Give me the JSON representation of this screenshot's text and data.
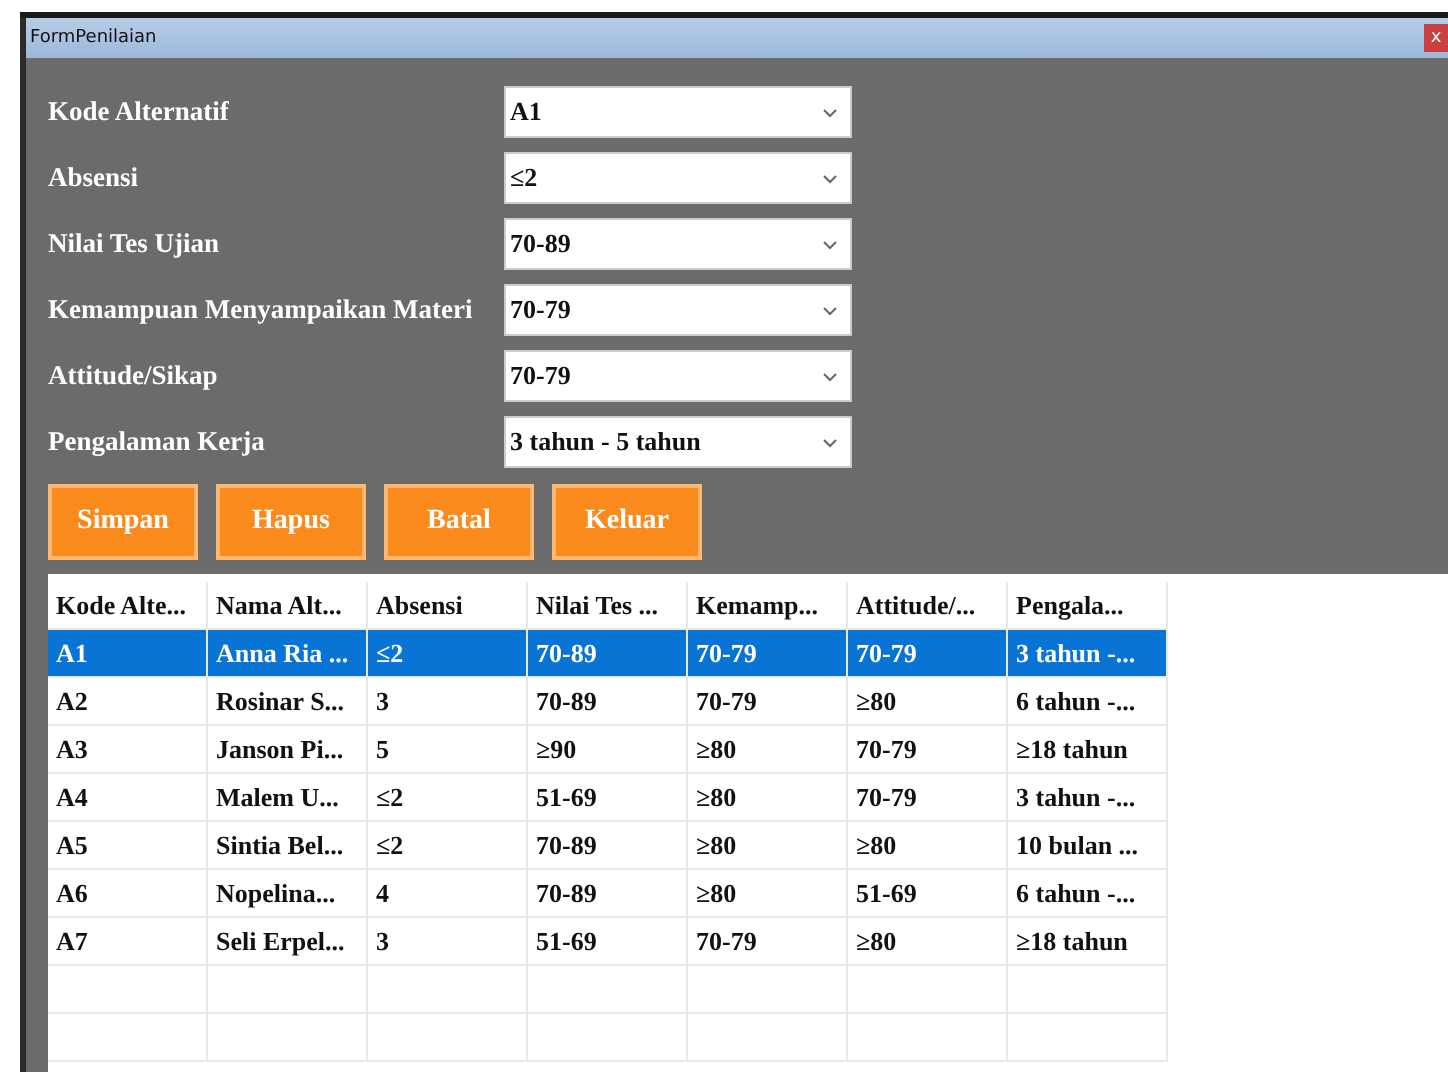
{
  "window": {
    "title": "FormPenilaian",
    "close": "x"
  },
  "fields": [
    {
      "label": "Kode Alternatif",
      "value": "A1"
    },
    {
      "label": "Absensi",
      "value": "≤2"
    },
    {
      "label": "Nilai Tes Ujian",
      "value": "70-89"
    },
    {
      "label": "Kemampuan Menyampaikan Materi",
      "value": "70-79"
    },
    {
      "label": "Attitude/Sikap",
      "value": "70-79"
    },
    {
      "label": "Pengalaman Kerja",
      "value": "3 tahun - 5 tahun"
    }
  ],
  "buttons": [
    "Simpan",
    "Hapus",
    "Batal",
    "Keluar"
  ],
  "table": {
    "columns": [
      "Kode Alte...",
      "Nama Alt...",
      "Absensi",
      "Nilai Tes ...",
      "Kemamp...",
      "Attitude/...",
      "Pengala..."
    ],
    "rows": [
      {
        "selected": true,
        "cells": [
          "A1",
          "Anna Ria ...",
          "≤2",
          "70-89",
          "70-79",
          "70-79",
          "3 tahun -..."
        ]
      },
      {
        "selected": false,
        "cells": [
          "A2",
          "Rosinar S...",
          "3",
          "70-89",
          "70-79",
          "≥80",
          "6 tahun -..."
        ]
      },
      {
        "selected": false,
        "cells": [
          "A3",
          "Janson Pi...",
          "5",
          "≥90",
          "≥80",
          "70-79",
          "≥18 tahun"
        ]
      },
      {
        "selected": false,
        "cells": [
          "A4",
          "Malem U...",
          "≤2",
          "51-69",
          "≥80",
          "70-79",
          "3 tahun -..."
        ]
      },
      {
        "selected": false,
        "cells": [
          "A5",
          "Sintia Bel...",
          "≤2",
          "70-89",
          "≥80",
          "≥80",
          "10 bulan ..."
        ]
      },
      {
        "selected": false,
        "cells": [
          "A6",
          "Nopelina...",
          "4",
          "70-89",
          "≥80",
          "51-69",
          "6 tahun -..."
        ]
      },
      {
        "selected": false,
        "cells": [
          "A7",
          "Seli Erpel...",
          "3",
          "51-69",
          "70-79",
          "≥80",
          "≥18 tahun"
        ]
      }
    ]
  }
}
